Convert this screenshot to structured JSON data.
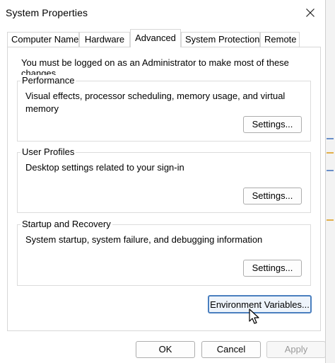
{
  "window": {
    "title": "System Properties",
    "close_glyph": "✕"
  },
  "tabs": [
    {
      "label": "Computer Name",
      "active": false
    },
    {
      "label": "Hardware",
      "active": false
    },
    {
      "label": "Advanced",
      "active": true
    },
    {
      "label": "System Protection",
      "active": false
    },
    {
      "label": "Remote",
      "active": false
    }
  ],
  "advanced": {
    "admin_note": "You must be logged on as an Administrator to make most of these changes.",
    "performance": {
      "label": "Performance",
      "description": "Visual effects, processor scheduling, memory usage, and virtual memory",
      "button": "Settings..."
    },
    "user_profiles": {
      "label": "User Profiles",
      "description": "Desktop settings related to your sign-in",
      "button": "Settings..."
    },
    "startup_recovery": {
      "label": "Startup and Recovery",
      "description": "System startup, system failure, and debugging information",
      "button": "Settings..."
    },
    "env_button": "Environment Variables..."
  },
  "footer": {
    "ok": "OK",
    "cancel": "Cancel",
    "apply": "Apply",
    "apply_enabled": false
  },
  "colors": {
    "focus_border": "#4a7fbf",
    "disabled_text": "#9a9a9a"
  },
  "icons": {
    "close": "close-icon",
    "cursor": "mouse-pointer-icon"
  }
}
